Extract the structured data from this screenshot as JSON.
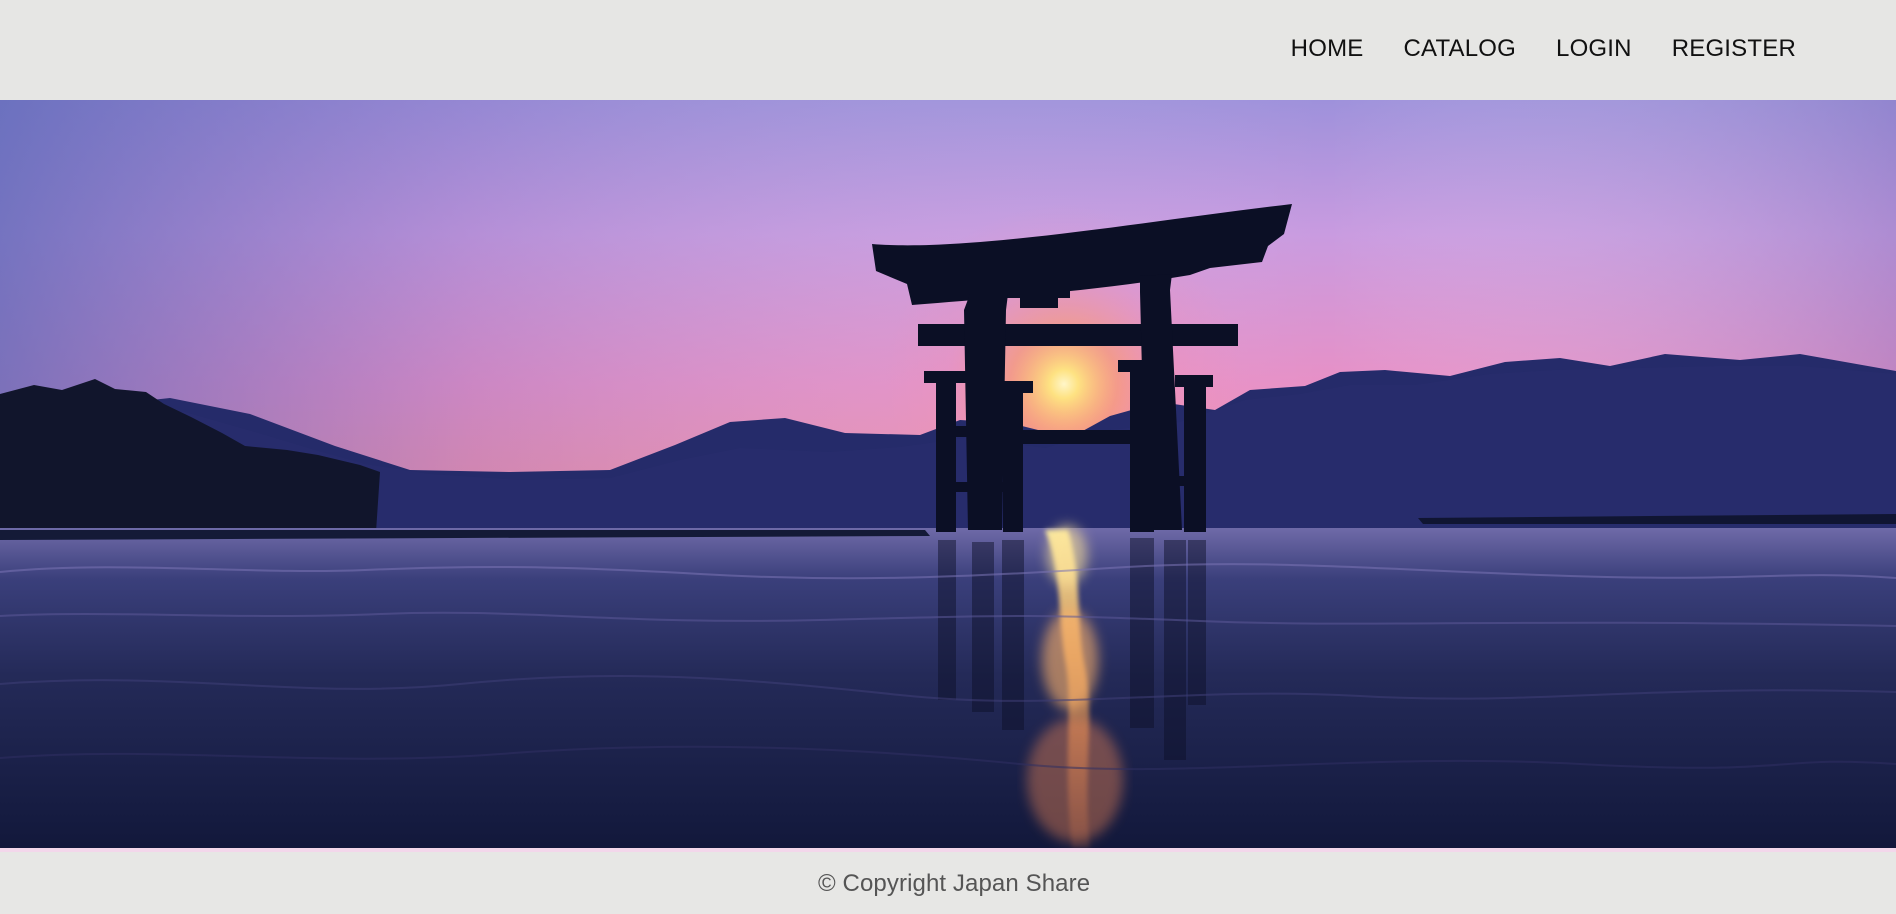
{
  "nav": {
    "items": [
      {
        "label": "HOME"
      },
      {
        "label": "CATALOG"
      },
      {
        "label": "LOGIN"
      },
      {
        "label": "REGISTER"
      }
    ]
  },
  "hero": {
    "image": "torii-gate-sunset-photo"
  },
  "footer": {
    "copyright": "© Copyright Japan Share"
  },
  "colors": {
    "topbar_bg": "#e6e6e4",
    "footer_bg": "#e7e7e5",
    "footer_accent": "#f3d7eb",
    "nav_text": "#111111",
    "footer_text": "#555555"
  }
}
